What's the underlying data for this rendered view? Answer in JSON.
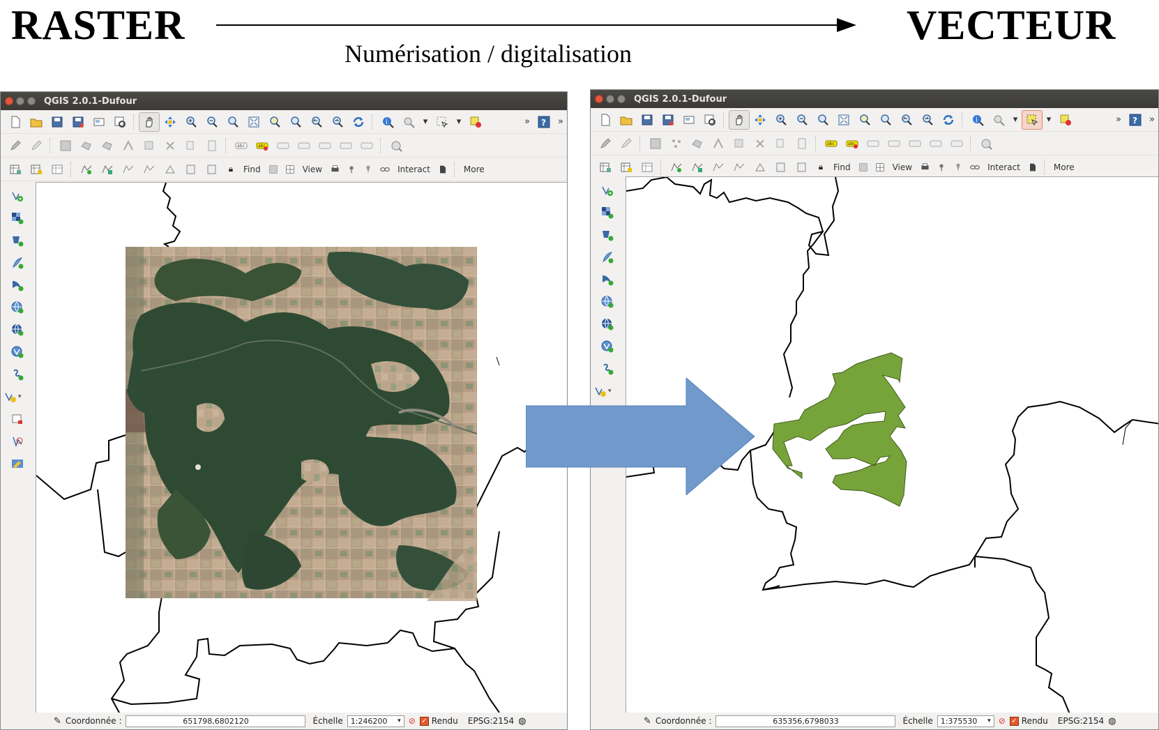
{
  "header": {
    "left_title": "RASTER",
    "right_title": "VECTEUR",
    "subtitle": "Numérisation / digitalisation"
  },
  "windows": [
    {
      "title": "QGIS 2.0.1-Dufour",
      "toolbar3": {
        "find": "Find",
        "view": "View",
        "interact": "Interact",
        "more": "More"
      },
      "status": {
        "coord_label": "Coordonnée :",
        "coord_value": "651798,6802120",
        "scale_label": "Échelle",
        "scale_value": "1:246200",
        "render_label": "Rendu",
        "crs": "EPSG:2154"
      }
    },
    {
      "title": "QGIS 2.0.1-Dufour",
      "toolbar3": {
        "find": "Find",
        "view": "View",
        "interact": "Interact",
        "more": "More"
      },
      "status": {
        "coord_label": "Coordonnée :",
        "coord_value": "635356,6798033",
        "scale_label": "Échelle",
        "scale_value": "1:375530",
        "render_label": "Rendu",
        "crs": "EPSG:2154"
      }
    }
  ],
  "colors": {
    "forest_polygon": "#77a43a",
    "transform_arrow": "#7099cc",
    "titlebar": "#3f3e3a",
    "close_button": "#e4573f"
  },
  "icons": {
    "toolbar1": [
      "new-project-icon",
      "open-project-icon",
      "save-project-icon",
      "save-as-icon",
      "new-print-composer-icon",
      "composer-manager-icon",
      "pan-icon",
      "pan-to-selection-icon",
      "zoom-in-icon",
      "zoom-out-icon",
      "zoom-native-icon",
      "zoom-full-icon",
      "zoom-to-selection-icon",
      "zoom-to-layer-icon",
      "zoom-last-icon",
      "zoom-next-icon",
      "refresh-icon",
      "identify-icon",
      "measure-icon",
      "select-icon",
      "deselect-icon",
      "help-icon"
    ],
    "sidebar": [
      "add-vector-layer-icon",
      "add-raster-layer-icon",
      "add-postgis-layer-icon",
      "add-spatialite-layer-icon",
      "add-mssql-layer-icon",
      "add-wms-layer-icon",
      "add-wcs-layer-icon",
      "add-wfs-layer-icon",
      "add-delimited-text-icon",
      "new-shapefile-icon",
      "remove-layer-icon",
      "gps-tools-icon",
      "edit-layer-icon"
    ]
  }
}
